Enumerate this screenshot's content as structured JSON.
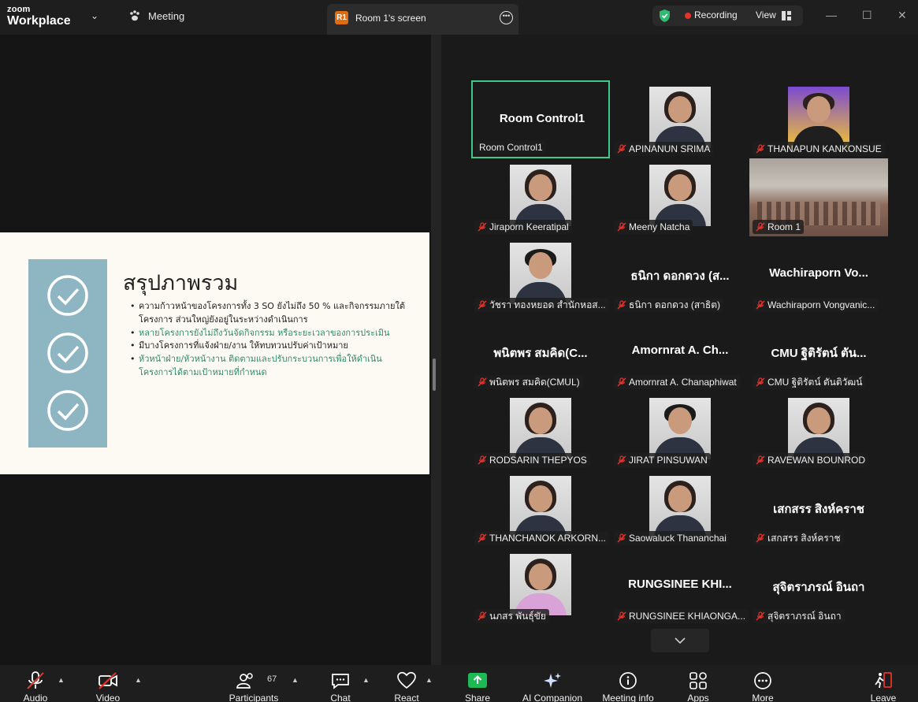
{
  "titlebar": {
    "logo_top": "zoom",
    "logo_bottom": "Workplace",
    "meeting_label": "Meeting",
    "tab_badge": "R1",
    "tab_title": "Room 1's screen",
    "recording_label": "Recording",
    "view_label": "View"
  },
  "slide": {
    "title": "สรุปภาพรวม",
    "bullets": [
      "ความก้าวหน้าของโครงการทั้ง 3 SO ยังไม่ถึง 50 % และกิจกรรมภายใต้โครงการ ส่วนใหญ่ยังอยู่ในระหว่างดำเนินการ",
      "หลายโครงการยังไม่ถึงวันจัดกิจกรรม หรือระยะเวลาของการประเมิน",
      "มีบางโครงการที่แจ้งฝ่าย/งาน ให้ทบทวนปรับค่าเป้าหมาย",
      "หัวหน้าฝ่าย/หัวหน้างาน ติดตามและปรับกระบวนการเพื่อให้ดำเนินโครงการได้ตามเป้าหมายที่กำหนด"
    ],
    "bullet_colors": [
      "#222222",
      "#2f8a6a",
      "#222222",
      "#2f8a6a"
    ]
  },
  "gallery": {
    "tiles": [
      {
        "name": "Room Control1",
        "big": "Room Control1",
        "muted": false
      },
      {
        "name": "APINANUN SRIMA",
        "photo": "female"
      },
      {
        "name": "THANAPUN KANKONSUE",
        "photo": "male-yellow"
      },
      {
        "name": "Jiraporn Keeratipal",
        "photo": "female"
      },
      {
        "name": "Meeny Natcha",
        "photo": "female"
      },
      {
        "name": "Room 1",
        "photo": "room"
      },
      {
        "name": "วัชรา ทองหยอด สำนักหอส...",
        "photo": "male"
      },
      {
        "name": "ธนิกา ดอกดวง (สาธิต)",
        "big": "ธนิกา ดอกดวง (ส..."
      },
      {
        "name": "Wachiraporn Vongvanic...",
        "big": "Wachiraporn Vo..."
      },
      {
        "name": "พนิตพร สมคิด(CMUL)",
        "big": "พนิตพร สมคิด(C..."
      },
      {
        "name": "Amornrat A. Chanaphiwat",
        "big": "Amornrat A. Ch..."
      },
      {
        "name": "CMU ฐิติรัตน์ ตันติวัฒน์",
        "big": "CMU ฐิติรัตน์ ตัน..."
      },
      {
        "name": "RODSARIN THEPYOS",
        "photo": "female"
      },
      {
        "name": "JIRAT PINSUWAN",
        "photo": "male"
      },
      {
        "name": "RAVEWAN BOUNROD",
        "photo": "female"
      },
      {
        "name": "THANCHANOK ARKORN...",
        "photo": "female"
      },
      {
        "name": "Saowaluck Thananchai",
        "photo": "female"
      },
      {
        "name": "เสกสรร สิงห์คราช",
        "big": "เสกสรร สิงห์คราช"
      },
      {
        "name": "นภสร พันธุ์ขัย",
        "photo": "female-pink"
      },
      {
        "name": "RUNGSINEE KHIAONGA...",
        "big": "RUNGSINEE KHI..."
      },
      {
        "name": "สุจิตราภรณ์ อินถา",
        "big": "สุจิตราภรณ์ อินถา"
      }
    ]
  },
  "toolbar": {
    "audio": "Audio",
    "video": "Video",
    "participants": "Participants",
    "participants_count": "67",
    "chat": "Chat",
    "react": "React",
    "share": "Share",
    "ai_companion": "AI Companion",
    "meeting_info": "Meeting info",
    "apps": "Apps",
    "more": "More",
    "leave": "Leave"
  },
  "colors": {
    "accent_green": "#41c98a",
    "recording_red": "#e5322b",
    "share_green": "#1db954",
    "leave_red": "#e5322b"
  }
}
